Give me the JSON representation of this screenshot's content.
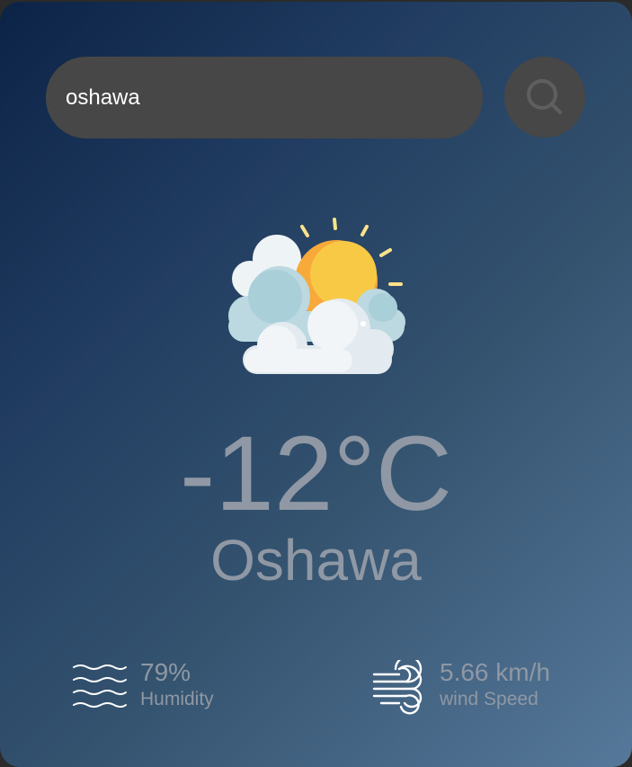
{
  "search": {
    "value": "oshawa",
    "icon": "search-icon"
  },
  "weather": {
    "icon": "partly-cloudy-icon",
    "temperature": "-12°C",
    "city": "Oshawa"
  },
  "details": {
    "humidity": {
      "icon": "humidity-icon",
      "value": "79%",
      "label": "Humidity"
    },
    "wind": {
      "icon": "wind-icon",
      "value": "5.66 km/h",
      "label": "wind Speed"
    }
  },
  "colors": {
    "card_gradient_start": "#0b2346",
    "card_gradient_end": "#56789a",
    "control_bg": "#474747",
    "text_muted": "#8f98a4",
    "sun": "#f9b233"
  }
}
